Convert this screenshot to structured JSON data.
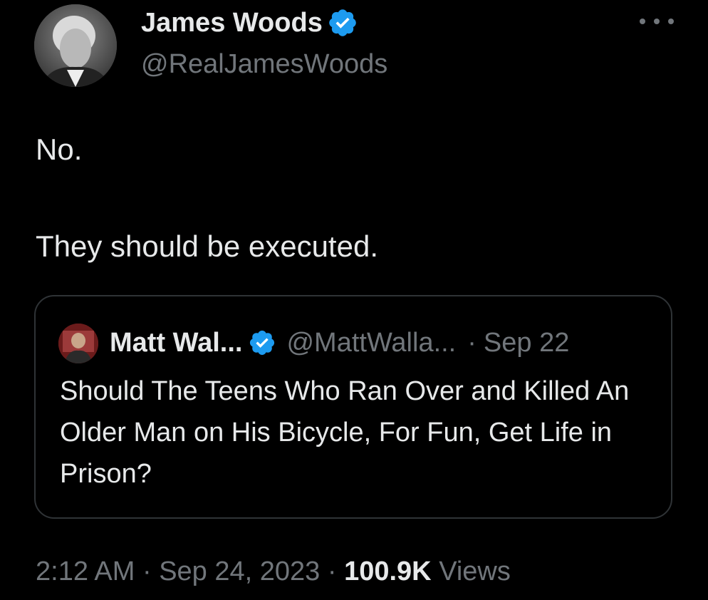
{
  "author": {
    "name": "James Woods",
    "handle": "@RealJamesWoods"
  },
  "tweet": {
    "lines": [
      "No.",
      "They should be executed."
    ]
  },
  "quoted": {
    "name": "Matt Wal...",
    "handle": "@MattWalla...",
    "separator": "·",
    "date": "Sep 22",
    "text": "Should The Teens Who Ran Over and Killed An Older Man on His Bicycle, For Fun, Get Life in Prison?"
  },
  "meta": {
    "time": "2:12 AM",
    "sep1": " · ",
    "date": "Sep 24, 2023",
    "sep2": " · ",
    "views_count": "100.9K",
    "views_label": "Views"
  },
  "icons": {
    "verified": "verified-badge-icon",
    "more": "more-options-icon"
  },
  "colors": {
    "background": "#000000",
    "primary_text": "#e7e9ea",
    "secondary_text": "#71767b",
    "verified": "#1d9bf0",
    "border": "#2f3336"
  }
}
